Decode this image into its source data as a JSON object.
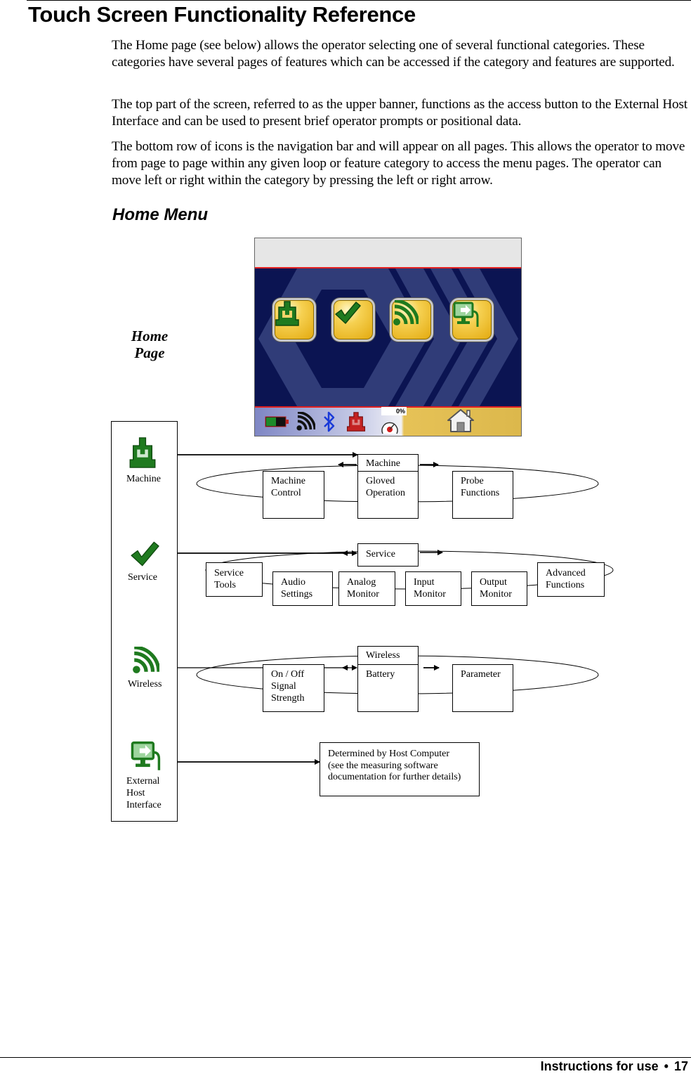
{
  "page": {
    "title": "Touch Screen Functionality Reference",
    "paragraphs": [
      "The Home page (see below) allows the operator selecting one of several functional categories. These categories have several pages of features which can be accessed if the category and features are supported.",
      "The top part of the screen, referred to as the upper banner, functions as the access button to the External Host Interface and can be used to present brief operator prompts or positional data.",
      "The bottom row of icons is the navigation bar and will appear on all pages. This allows the operator to move from page to page within any given loop or feature category to access the menu pages. The operator can move left or right within the category by pressing the left or right arrow."
    ],
    "section_heading": "Home Menu",
    "home_page_label_line1": "Home",
    "home_page_label_line2": "Page"
  },
  "device_screen": {
    "banner_text": "",
    "category_buttons": [
      {
        "name": "machine",
        "icon": "machine-icon"
      },
      {
        "name": "service",
        "icon": "checkmark-icon"
      },
      {
        "name": "wireless",
        "icon": "wireless-icon"
      },
      {
        "name": "external-host-interface",
        "icon": "monitor-arrow-icon"
      }
    ],
    "nav_bar": {
      "icons": [
        "battery-icon",
        "signal-icon",
        "bluetooth-icon",
        "machine-icon",
        "gauge-icon",
        "home-icon"
      ],
      "percent_readout": "0%",
      "battery_level": 0.5
    },
    "colors": {
      "accent_red": "#e32020",
      "screen_navy": "#0b1452",
      "icon_green": "#1f7a1f",
      "button_gold": "#f0c53a"
    }
  },
  "diagram": {
    "categories": [
      {
        "label": "Machine",
        "icon": "machine-icon"
      },
      {
        "label": "Service",
        "icon": "checkmark-icon"
      },
      {
        "label": "Wireless",
        "icon": "wireless-icon"
      },
      {
        "label_lines": [
          "External",
          "Host",
          "Interface"
        ],
        "icon": "monitor-arrow-icon"
      }
    ],
    "machine_loop": {
      "header": "Machine",
      "pages": [
        {
          "lines": [
            "Machine",
            "Control"
          ]
        },
        {
          "lines": [
            "Gloved",
            "Operation"
          ]
        },
        {
          "lines": [
            "Probe",
            "Functions"
          ]
        }
      ]
    },
    "service_loop": {
      "header": "Service",
      "pages": [
        {
          "lines": [
            "Service",
            "Tools"
          ]
        },
        {
          "lines": [
            "Audio",
            "Settings"
          ]
        },
        {
          "lines": [
            "Analog",
            "Monitor"
          ]
        },
        {
          "lines": [
            "Input",
            "Monitor"
          ]
        },
        {
          "lines": [
            "Output",
            "Monitor"
          ]
        },
        {
          "lines": [
            "Advanced",
            "Functions"
          ]
        }
      ]
    },
    "wireless_loop": {
      "header": "Wireless",
      "pages": [
        {
          "lines": [
            "On / Off",
            "Signal",
            "Strength"
          ]
        },
        {
          "lines": [
            "Battery"
          ]
        },
        {
          "lines": [
            "Parameter"
          ]
        }
      ]
    },
    "external_host": {
      "lines": [
        "Determined by Host Computer",
        "(see the measuring software",
        "documentation for further details)"
      ]
    }
  },
  "footer": {
    "text": "Instructions for use",
    "bullet": "•",
    "page_number": "17"
  }
}
